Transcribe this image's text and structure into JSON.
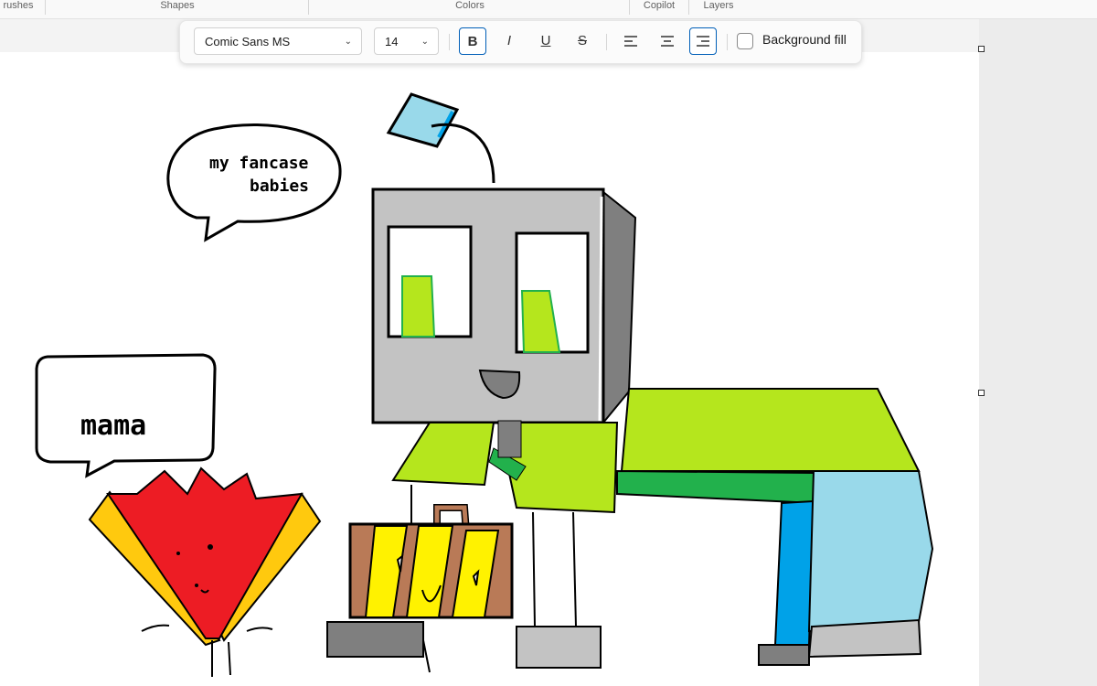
{
  "ribbon": {
    "groups": [
      "rushes",
      "Shapes",
      "Colors",
      "Copilot",
      "Layers"
    ]
  },
  "text_toolbar": {
    "font_family": "Comic Sans MS",
    "font_size": "14",
    "bold_glyph": "B",
    "italic_glyph": "I",
    "underline_glyph": "U",
    "strike_glyph": "S",
    "background_fill_label": "Background fill",
    "background_fill_checked": false,
    "active_alignment": "right"
  },
  "canvas": {
    "speech_bubble_1": "my fancase\n      babies",
    "speech_bubble_1_line1": "my fancase",
    "speech_bubble_1_line2": "babies",
    "speech_bubble_2": "mama"
  },
  "colors": {
    "accent": "#005fb8",
    "robot_gray": "#c3c3c3",
    "lime": "#b5e61d",
    "green": "#22b14c",
    "red": "#ed1c24",
    "orange": "#ffc90e",
    "brown": "#b97a57",
    "yellow": "#fff200",
    "light_blue": "#99d9ea",
    "blue": "#00a2e8"
  }
}
